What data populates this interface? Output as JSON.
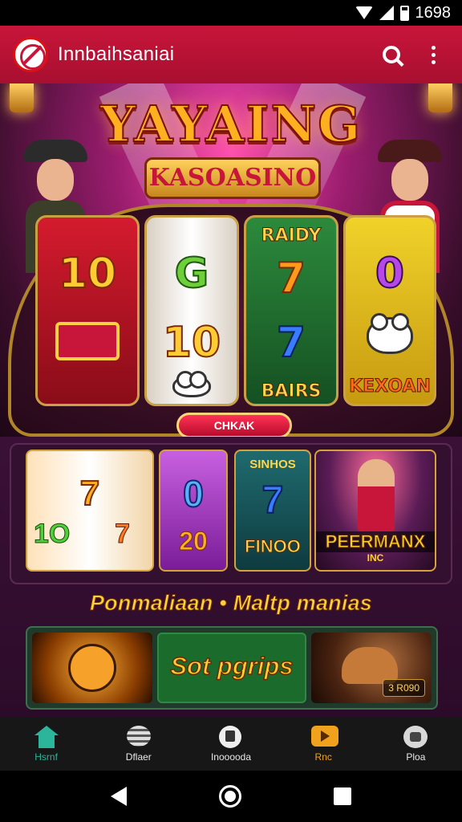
{
  "status_bar": {
    "time": "1698",
    "icons": [
      "wifi-icon",
      "signal-icon",
      "battery-icon"
    ]
  },
  "app_bar": {
    "title": "Innbaihsaniai",
    "icons": [
      "logo-icon",
      "search-icon",
      "more-vert-icon"
    ],
    "accent_color": "#c8153a"
  },
  "hero": {
    "title": "YAYAING",
    "subtitle": "KASOASINO",
    "reels": [
      {
        "top": "10",
        "bottom_icon": "ticket-icon"
      },
      {
        "top": "G",
        "middle": "10",
        "bottom_icon": "lamb-icon"
      },
      {
        "top_label": "RAIDY",
        "middle": "7",
        "mid2": "7",
        "bottom_label": "BAIRS"
      },
      {
        "top": "0",
        "bottom_label": "KEXOAN"
      }
    ],
    "spin_button": "CHKAK"
  },
  "tiles": [
    {
      "name": "slot-tile-sevens",
      "labels": [
        "7",
        "1O",
        "7"
      ]
    },
    {
      "name": "slot-tile-zero",
      "labels": [
        "0",
        "20"
      ]
    },
    {
      "name": "slot-tile-sinhos",
      "title": "SINHOS",
      "value": "7",
      "label": "FINOO"
    },
    {
      "name": "slot-tile-peermanx",
      "title": "PEERMANX",
      "subtitle": "INC"
    }
  ],
  "section_title": "Ponmaliaan • Maltp manias",
  "promos": [
    {
      "name": "promo-tiger-left"
    },
    {
      "name": "promo-slot-pgrips",
      "label": "Sot pgrips"
    },
    {
      "name": "promo-tiger-right",
      "badge": "3 R090"
    }
  ],
  "bottom_nav": [
    {
      "label": "Hsrnf",
      "icon": "home-icon",
      "active": true
    },
    {
      "label": "Dflaer",
      "icon": "games-icon",
      "active": false
    },
    {
      "label": "Inooooda",
      "icon": "trophy-icon",
      "active": false
    },
    {
      "label": "Rnc",
      "icon": "promo-icon",
      "active": false
    },
    {
      "label": "Ploa",
      "icon": "profile-icon",
      "active": false
    }
  ],
  "nav_active_color": "#2bb59a"
}
